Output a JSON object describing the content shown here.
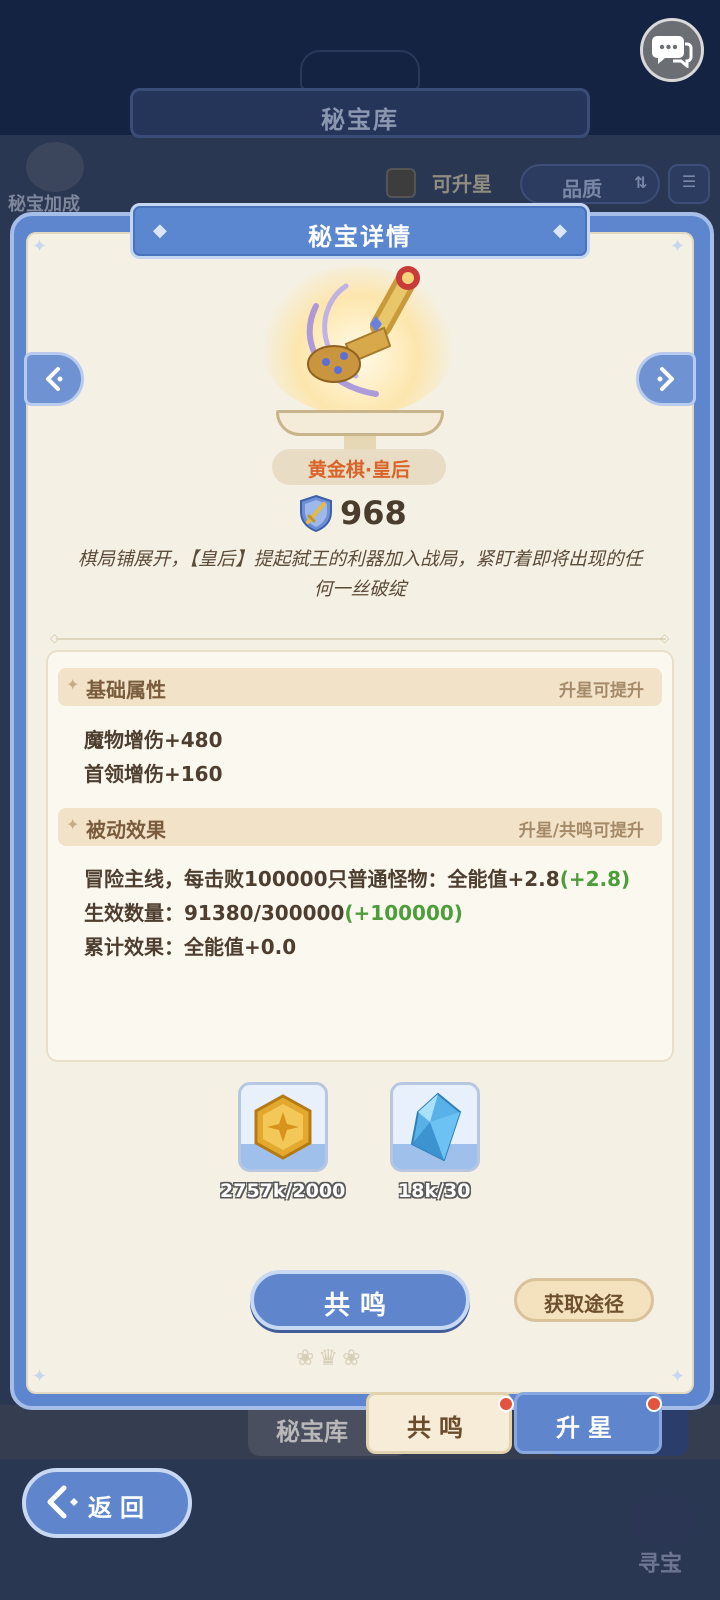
{
  "background": {
    "page_title": "秘宝库",
    "bonus_label": "秘宝加成",
    "filter_upgradable_label": "可升星",
    "sort_label": "品质",
    "bottom_tab_vault": "秘宝库",
    "treasure_hunt_label": "寻宝"
  },
  "dialog": {
    "title": "秘宝详情",
    "item_name": "黄金棋·皇后",
    "power": "968",
    "description": "棋局铺展开，【皇后】提起弑王的利器加入战局，紧盯着即将出现的任何一丝破绽"
  },
  "basic_attributes": {
    "title": "基础属性",
    "note": "升星可提升",
    "lines": [
      "魔物增伤+480",
      "首领增伤+160"
    ]
  },
  "passive_effect": {
    "title": "被动效果",
    "note": "升星/共鸣可提升",
    "line1_main": "冒险主线，每击败100000只普通怪物：全能值+2.8",
    "line1_bonus": "(+2.8)",
    "line2_main": "生效数量：91380/300000",
    "line2_bonus": "(+100000)",
    "line3": "累计效果：全能值+0.0"
  },
  "materials": [
    {
      "icon": "gold-medal-icon",
      "count": "2757k/2000"
    },
    {
      "icon": "blue-crystal-icon",
      "count": "18k/30"
    }
  ],
  "buttons": {
    "resonate": "共鸣",
    "obtain_path": "获取途径",
    "back": "返回"
  },
  "tabs": {
    "resonate": "共鸣",
    "star_up": "升星"
  },
  "colors": {
    "accent_blue": "#5f86cc",
    "item_name": "#d9642a",
    "bonus_green": "#4d9d3a",
    "notification_red": "#e4533e"
  }
}
